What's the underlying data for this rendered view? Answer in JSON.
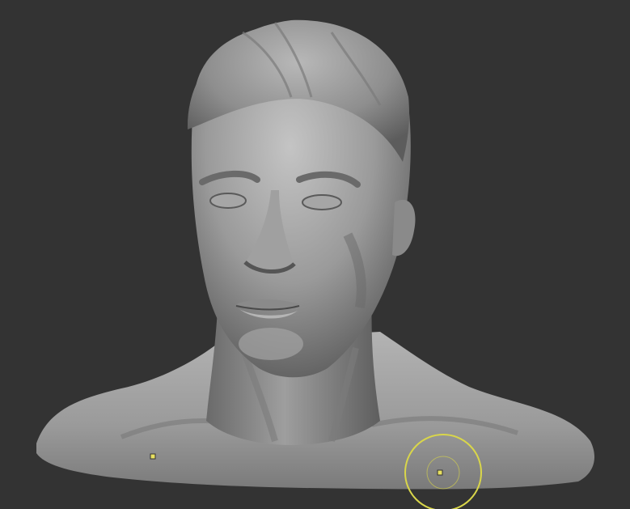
{
  "viewport": {
    "background_color": "#333333"
  },
  "model": {
    "kind": "sculpted-bust",
    "base_color": "#8f8f8f",
    "highlight_color": "#c9c9c9",
    "shadow_color": "#4a4a4a"
  },
  "brush_cursor": {
    "ring_color": "#d9d64a",
    "center_color": "#e8e060"
  },
  "markers": {
    "color": "#e8e060"
  }
}
